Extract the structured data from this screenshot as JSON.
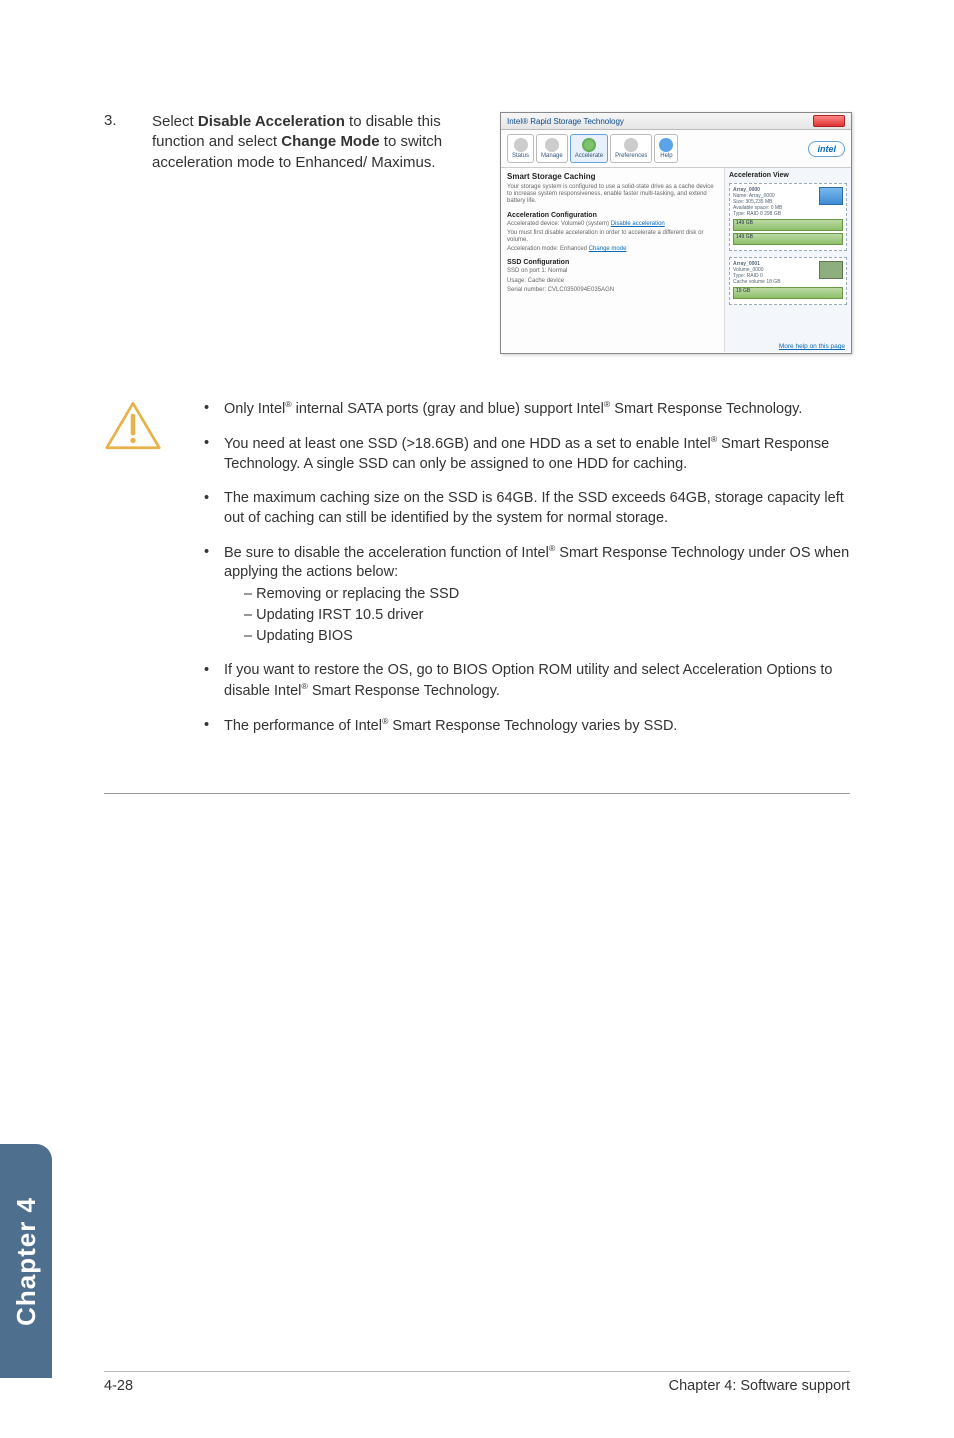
{
  "step": {
    "number": "3.",
    "text_before_disable": "Select ",
    "disable_label": "Disable Acceleration",
    "text_mid": " to disable this function and select ",
    "change_label": "Change Mode",
    "text_after": " to switch acceleration mode to Enhanced/ Maximus."
  },
  "screenshot": {
    "window_title": "Intel® Rapid Storage Technology",
    "tabs": {
      "status": "Status",
      "manage": "Manage",
      "accelerate": "Accelerate",
      "preferences": "Preferences",
      "help": "Help"
    },
    "intel_logo": "intel",
    "left_panel": {
      "heading": "Smart Storage Caching",
      "intro": "Your storage system is configured to use a solid-state drive as a cache device to increase system responsiveness, enable faster multi-tasking, and extend battery life.",
      "accel_config_h": "Acceleration Configuration",
      "accel_device": "Accelerated device: Volume0 (system) ",
      "disable_link": "Disable acceleration",
      "must_first": "You must first disable acceleration in order to accelerate a different disk or volume.",
      "accel_mode": "Acceleration mode: Enhanced ",
      "change_link": "Change mode",
      "ssd_config_h": "SSD Configuration",
      "ssd_port": "SSD on port 1: Normal",
      "usage": "Usage: Cache device",
      "serial": "Serial number: CVLC0350094E035AGN"
    },
    "right_panel": {
      "heading": "Acceleration View",
      "array0": {
        "label": "Array_0000",
        "name_line": "Name: Array_0000",
        "size_line": "Size: 305,235 MB",
        "avail_line": "Available space: 0 MB",
        "type_line": "Type: RAID 0 298 GB",
        "bar1": "149 GB",
        "bar2": "149 GB"
      },
      "array1": {
        "label": "Array_0001",
        "vol": "Volume_0000",
        "type": "Type: RAID 0",
        "cache": "Cache volume 18 GB",
        "bar": "19 GB"
      }
    },
    "more_help": "More help on this page"
  },
  "notes": {
    "items": [
      {
        "pre": "Only Intel",
        "mid1": " internal SATA ports (gray and blue) support Intel",
        "tail": " Smart Response Technology."
      },
      {
        "pre": "You need at least one SSD (>18.6GB) and one HDD as a set to enable Intel",
        "tail": " Smart Response Technology. A single SSD can only be assigned to one HDD for caching."
      },
      {
        "text": "The maximum caching size on the SSD is 64GB. If the SSD exceeds 64GB, storage capacity left out of caching can still be identified by the system for normal storage."
      },
      {
        "pre": "Be sure to disable the acceleration function of Intel",
        "tail": " Smart Response Technology under OS when applying the actions below:",
        "sub": [
          "– Removing or replacing the SSD",
          "– Updating IRST 10.5 driver",
          "– Updating BIOS"
        ]
      },
      {
        "pre": "If you want to restore the OS, go to BIOS Option ROM utility and select Acceleration Options to disable Intel",
        "tail": " Smart Response Technology."
      },
      {
        "pre": "The performance of Intel",
        "tail": " Smart Response Technology varies by SSD."
      }
    ]
  },
  "reg_mark": "®",
  "side_tab": "Chapter 4",
  "footer": {
    "left": "4-28",
    "right": "Chapter 4: Software support"
  }
}
